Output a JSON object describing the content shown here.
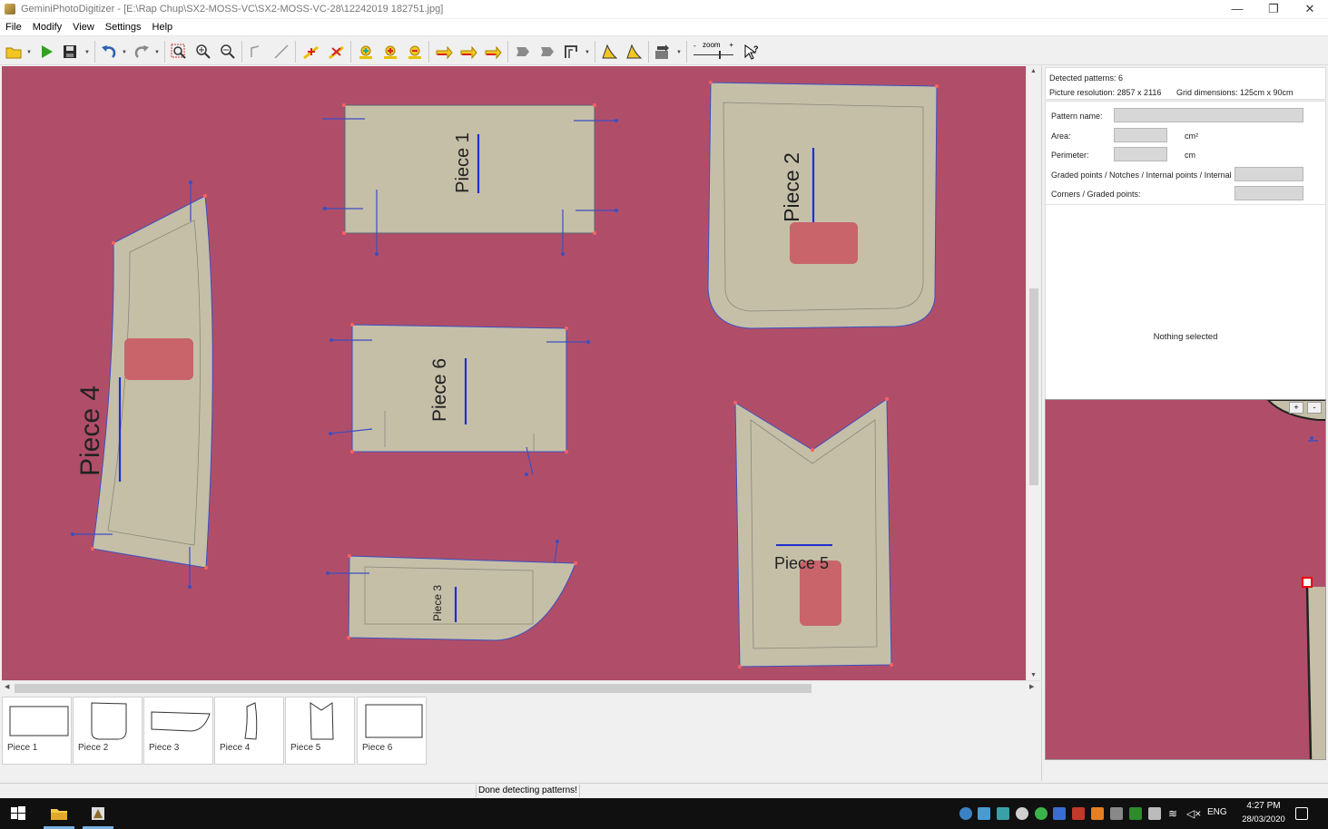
{
  "window": {
    "title": "GeminiPhotoDigitizer - [E:\\Rap Chup\\SX2-MOSS-VC\\SX2-MOSS-VC-28\\12242019 182751.jpg]",
    "minimize": "—",
    "maximize": "❐",
    "close": "✕"
  },
  "menu": [
    "File",
    "Modify",
    "View",
    "Settings",
    "Help"
  ],
  "toolbar": {
    "zoom_label": "zoom",
    "zoom_minus": "-",
    "zoom_plus": "+",
    "icons": [
      "open-icon",
      "play-icon",
      "save-icon",
      "undo-icon",
      "redo-icon",
      "zoom-fit-icon",
      "zoom-in-icon",
      "zoom-out-icon",
      "line-tool-icon",
      "draw-line-icon",
      "add-notch-icon",
      "remove-notch-icon",
      "add-point-icon",
      "add-grade-point-icon",
      "remove-point-icon",
      "arrow-right-icon",
      "arrow-right-2-icon",
      "arrow-right-3-icon",
      "shape-tool-icon",
      "shape-tool-2-icon",
      "corner-tool-icon",
      "curve-tool-icon",
      "curve-tool-2-icon",
      "export-icon",
      "help-cursor-icon"
    ]
  },
  "canvas": {
    "background_color": "#b04e69",
    "piece_color": "#c5bfa8",
    "pieces": [
      {
        "name": "Piece 1",
        "label": "Piece 1"
      },
      {
        "name": "Piece 2",
        "label": "Piece 2"
      },
      {
        "name": "Piece 3",
        "label": "Piece 3"
      },
      {
        "name": "Piece 4",
        "label": "Piece 4"
      },
      {
        "name": "Piece 5",
        "label": "Piece 5"
      },
      {
        "name": "Piece 6",
        "label": "Piece 6"
      }
    ]
  },
  "thumbnails": [
    {
      "label": "Piece 1"
    },
    {
      "label": "Piece 2"
    },
    {
      "label": "Piece 3"
    },
    {
      "label": "Piece 4"
    },
    {
      "label": "Piece 5"
    },
    {
      "label": "Piece 6"
    }
  ],
  "info": {
    "detected_patterns": "Detected patterns: 6",
    "picture_resolution": "Picture resolution: 2857 x 2116",
    "grid_dimensions": "Grid dimensions: 125cm x 90cm"
  },
  "properties": {
    "pattern_name_label": "Pattern name:",
    "pattern_name_value": "",
    "area_label": "Area:",
    "area_unit": "cm²",
    "area_value": "",
    "perimeter_label": "Perimeter:",
    "perimeter_unit": "cm",
    "perimeter_value": "",
    "graded_label": "Graded points / Notches / Internal points / Internal",
    "graded_value": "",
    "corners_label": "Corners / Graded points:",
    "corners_value": "",
    "nothing_selected": "Nothing selected"
  },
  "preview": {
    "plus": "+",
    "minus": "-"
  },
  "status": {
    "message": "Done detecting patterns!"
  },
  "taskbar": {
    "language": "ENG",
    "time": "4:27 PM",
    "date": "28/03/2020"
  }
}
